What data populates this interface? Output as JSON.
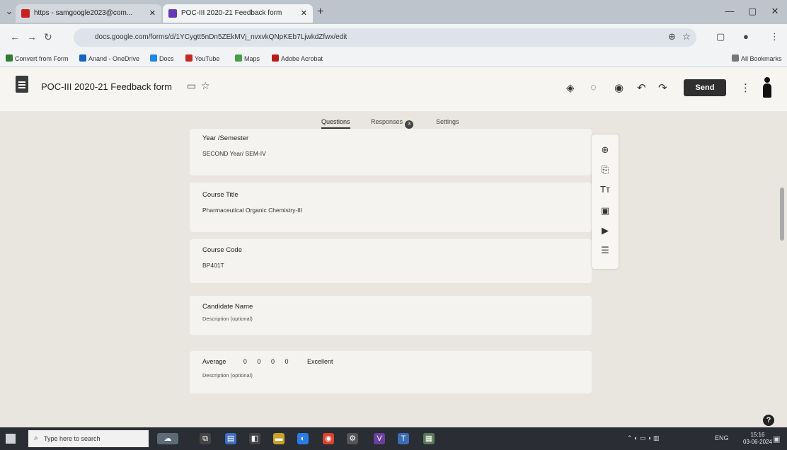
{
  "browser": {
    "tabs": [
      {
        "label": "https - samgoogle2023@com...",
        "active": false
      },
      {
        "label": "POC-III 2020-21 Feedback form",
        "active": true
      }
    ],
    "url": "docs.google.com/forms/d/1YCygtt5nDn5ZEkMVj_nvxvkQNpKEb7LjwkdZfwx/edit",
    "bookmarks": [
      "Convert from Form",
      "Anand - OneDrive",
      "Docs",
      "YouTube",
      "Maps",
      "Adobe Acrobat"
    ],
    "all_bookmarks": "All Bookmarks"
  },
  "form": {
    "title": "POC-III 2020-21 Feedback form",
    "send_label": "Send",
    "tabs": {
      "questions": "Questions",
      "responses": "Responses",
      "responses_count": "3",
      "settings": "Settings"
    }
  },
  "questions": [
    {
      "label": "Year /Semester",
      "value": "SECOND Year/ SEM-IV"
    },
    {
      "label": "Course Title",
      "value": "Pharmaceutical Organic Chemistry-III"
    },
    {
      "label": "Course Code",
      "value": "BP401T"
    },
    {
      "label": "Candidate Name",
      "description": "Description (optional)"
    },
    {
      "label": "Average",
      "scale": [
        "0",
        "0",
        "0",
        "0"
      ],
      "max_label": "Excellent",
      "description": "Description (optional)"
    }
  ],
  "taskbar": {
    "search_placeholder": "Type here to search",
    "time": "15:16",
    "date": "03-06-2024",
    "lang": "ENG"
  }
}
